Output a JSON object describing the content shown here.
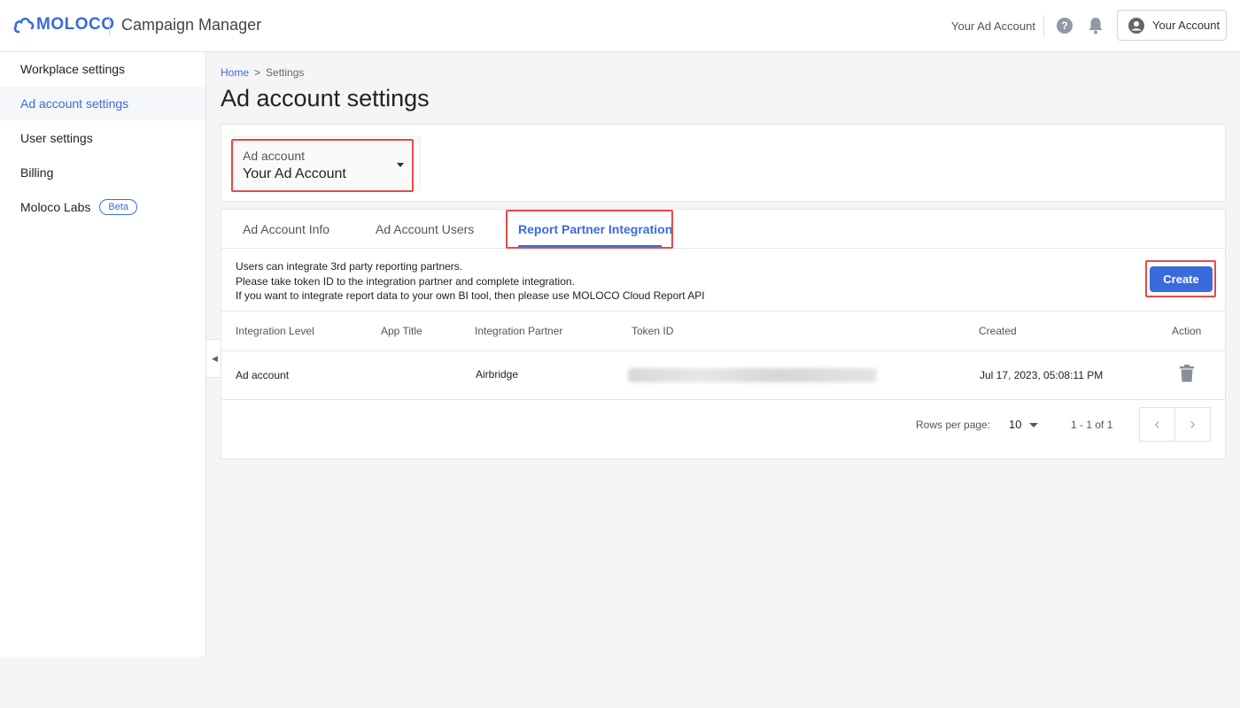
{
  "header": {
    "logo_text": "MOLOCO",
    "app_title": "Campaign Manager",
    "ad_account": "Your Ad Account",
    "account_button": "Your Account",
    "help_glyph": "?"
  },
  "sidebar": {
    "items": [
      {
        "label": "Workplace settings"
      },
      {
        "label": "Ad account settings",
        "active": true
      },
      {
        "label": "User settings"
      },
      {
        "label": "Billing"
      },
      {
        "label": "Moloco Labs",
        "badge": "Beta"
      }
    ]
  },
  "breadcrumb": {
    "home": "Home",
    "separator": ">",
    "current": "Settings"
  },
  "page_title": "Ad account settings",
  "ad_account_select": {
    "label": "Ad account",
    "value": "Your Ad Account"
  },
  "tabs": [
    {
      "label": "Ad Account Info"
    },
    {
      "label": "Ad Account Users"
    },
    {
      "label": "Report Partner Integration",
      "active": true
    }
  ],
  "description": {
    "line1": "Users can integrate 3rd party reporting partners.",
    "line2": "Please take token ID to the integration partner and complete integration.",
    "line3": "If you want to integrate report data to your own BI tool, then please use MOLOCO Cloud Report API"
  },
  "create_button": "Create",
  "table": {
    "columns": [
      "Integration Level",
      "App Title",
      "Integration Partner",
      "Token ID",
      "Created",
      "Action"
    ],
    "rows": [
      {
        "integration_level": "Ad account",
        "app_title": "",
        "integration_partner": "Airbridge",
        "token_id": "",
        "created": "Jul 17, 2023, 05:08:11 PM",
        "action_icon": "trash-icon"
      }
    ]
  },
  "pagination": {
    "rows_label": "Rows per page:",
    "rows_value": "10",
    "range": "1 - 1 of 1",
    "prev_glyph": "‹",
    "next_glyph": "›"
  },
  "colors": {
    "accent": "#3a6bdc",
    "highlight": "#e14c4c"
  }
}
